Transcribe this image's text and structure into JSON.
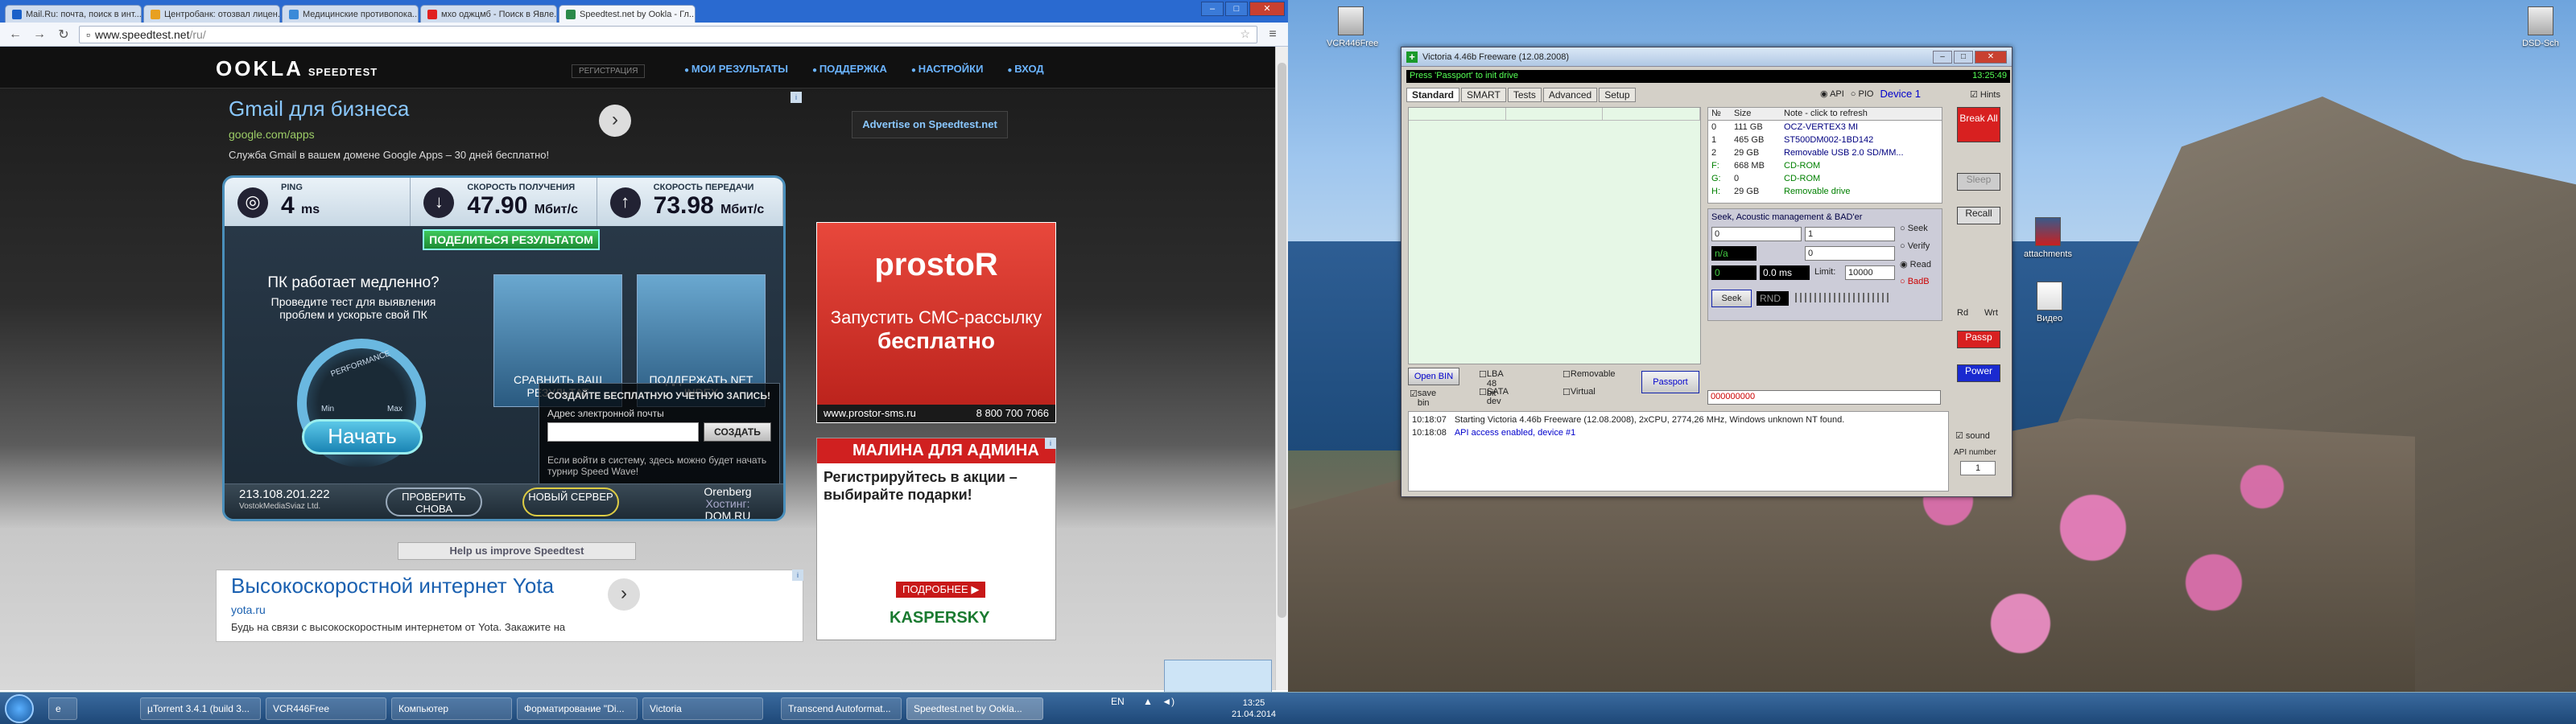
{
  "browser": {
    "tabs": [
      {
        "label": "Mail.Ru: почта, поиск в инт...",
        "active": false
      },
      {
        "label": "Центробанк: отозвал лицен...",
        "active": false
      },
      {
        "label": "Медицинские противопока...",
        "active": false
      },
      {
        "label": "мхо оджцмб - Поиск в Явле...",
        "active": false
      },
      {
        "label": "Speedtest.net by Ookla - Гл...",
        "active": true
      }
    ],
    "url_host": "www.speedtest.net",
    "url_path": "/ru/"
  },
  "speedtest": {
    "logo": "OOKLA",
    "logo_sub": "SPEEDTEST",
    "register": "РЕГИСТРАЦИЯ",
    "nav": [
      "МОИ РЕЗУЛЬТАТЫ",
      "ПОДДЕРЖКА",
      "НАСТРОЙКИ",
      "ВХОД"
    ],
    "ad_gmail": {
      "title": "Gmail для бизнеса",
      "url": "google.com/apps",
      "desc": "Служба Gmail в вашем домене Google Apps – 30 дней бесплатно!"
    },
    "advertise": "Advertise on Speedtest.net",
    "ping": {
      "label": "PING",
      "value": "4",
      "unit": "ms"
    },
    "download": {
      "label": "СКОРОСТЬ ПОЛУЧЕНИЯ",
      "value": "47.90",
      "unit": "Мбит/с"
    },
    "upload": {
      "label": "СКОРОСТЬ ПЕРЕДАЧИ",
      "value": "73.98",
      "unit": "Мбит/с"
    },
    "share": "ПОДЕЛИТЬСЯ РЕЗУЛЬТАТОМ",
    "slow_title": "ПК работает медленно?",
    "slow_desc": "Проведите тест для выявления проблем и ускорьте свой ПК",
    "gauge_min": "Min",
    "gauge_max": "Max",
    "gauge_label": "PERFORMANCE",
    "start": "Начать",
    "compare": "СРАВНИТЬ ВАШ РЕЗУЛЬТАТ",
    "netindex": "ПОДДЕРЖАТЬ NET INDEX",
    "signup_title": "СОЗДАЙТЕ БЕСПЛАТНУЮ УЧЕТНУЮ ЗАПИСЬ!",
    "signup_email": "Адрес электронной почты",
    "signup_button": "СОЗДАТЬ",
    "signup_note": "Если войти в систему, здесь можно будет начать турнир Speed Wave!",
    "ip": "213.108.201.222",
    "isp": "VostokMediaSviaz Ltd.",
    "retest": "ПРОВЕРИТЬ СНОВА",
    "new_server": "НОВЫЙ СЕРВЕР",
    "host_city": "Orenberg",
    "host_label": "Хостинг:",
    "host_name": "DOM.RU",
    "ad_prostor": {
      "logo": "prostoR",
      "line1": "Запустить СМС-рассылку",
      "line2": "бесплатно",
      "site": "www.prostor-sms.ru",
      "phone": "8 800 700 7066"
    },
    "ad_kaspersky": {
      "head": "МАЛИНА ДЛЯ АДМИНА",
      "text": "Регистрируйтесь в акции – выбирайте подарки!",
      "more": "ПОДРОБНЕЕ ▶",
      "brand": "KASPERSKY"
    },
    "help": "Help us improve Speedtest",
    "ad_yota": {
      "title": "Высокоскоростной интернет Yota",
      "url": "yota.ru",
      "desc": "Будь на связи с высокоскоростным интернетом от Yota. Закажите на"
    }
  },
  "taskbar": {
    "items": [
      "µTorrent 3.4.1 (build 3...",
      "VCR446Free",
      "Компьютер",
      "Форматирование \"Di...",
      "Victoria",
      "Transcend Autoformat...",
      "Speedtest.net by Ookla..."
    ],
    "lang": "EN",
    "time": "13:25",
    "date": "21.04.2014"
  },
  "desktop": {
    "icons": [
      "VCR446Free",
      "DSD-Sch",
      "attachments",
      "Видео"
    ]
  },
  "victoria": {
    "title": "Victoria 4.46b Freeware (12.08.2008)",
    "status": "Press 'Passport' to init drive",
    "clock": "13:25:49",
    "tabs": [
      "Standard",
      "SMART",
      "Tests",
      "Advanced",
      "Setup"
    ],
    "api": "API",
    "pio": "PIO",
    "device": "Device 1",
    "hints": "Hints",
    "drive_head": [
      "№",
      "Size",
      "Note - click to refresh"
    ],
    "drives": [
      {
        "n": "0",
        "size": "111 GB",
        "note": "OCZ-VERTEX3 MI",
        "color": "#000080"
      },
      {
        "n": "1",
        "size": "465 GB",
        "note": "ST500DM002-1BD142",
        "color": "#000080"
      },
      {
        "n": "2",
        "size": "29 GB",
        "note": "Removable USB 2.0 SD/MM...",
        "color": "#000080"
      },
      {
        "n": "F:",
        "size": "668 MB",
        "note": "CD-ROM",
        "color": "#008000"
      },
      {
        "n": "G:",
        "size": "0",
        "note": "CD-ROM",
        "color": "#008000"
      },
      {
        "n": "H:",
        "size": "29 GB",
        "note": "Removable drive",
        "color": "#008000"
      }
    ],
    "seek_title": "Seek, Acoustic management & BAD'er",
    "from": "0",
    "to": "1",
    "na": "n/a",
    "field3": "0",
    "field4": "0",
    "ms": "0.0 ms",
    "limit_label": "Limit:",
    "limit": "10000",
    "radio_seek": [
      "Seek",
      "Verify",
      "Read",
      "BadB"
    ],
    "seek_btn": "Seek",
    "rnd": "RND",
    "options": [
      "Open BIN",
      "save bin",
      "LBA 48 bit",
      "SATA dev",
      "Removable",
      "Virtual"
    ],
    "passport": "Passport",
    "serial": "000000000",
    "log": [
      {
        "time": "10:18:07",
        "msg": "Starting Victoria 4.46b Freeware (12.08.2008), 2xCPU, 2774,26 MHz, Windows unknown NT found."
      },
      {
        "time": "10:18:08",
        "msg": "API access enabled, device #1"
      }
    ],
    "right": {
      "break": "Break All",
      "sleep": "Sleep",
      "recall": "Recall",
      "rd": "Rd",
      "wrt": "Wrt",
      "passp": "Passp",
      "power": "Power",
      "sound": "sound",
      "api_number_label": "API number",
      "api_number": "1"
    }
  }
}
